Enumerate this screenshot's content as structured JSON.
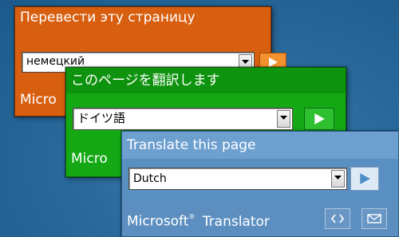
{
  "widgets": [
    {
      "language": "ru",
      "title": "Перевести эту страницу",
      "selected_language": "немецкий",
      "footer_brand": "Micro",
      "colors": {
        "background": "#d85f10",
        "go_button": "#f3922e"
      }
    },
    {
      "language": "ja",
      "title": "このページを翻訳します",
      "selected_language": "ドイツ語",
      "footer_brand": "Micro",
      "colors": {
        "background": "#14a914",
        "go_button": "#2fc02f"
      }
    },
    {
      "language": "en",
      "title": "Translate this page",
      "selected_language": "Dutch",
      "footer_brand": "Microsoft",
      "footer_product": "Translator",
      "colors": {
        "background": "#5a8fc1",
        "go_button": "#dde9f5"
      },
      "footer_icons": [
        "code-embed-icon",
        "email-icon"
      ]
    }
  ],
  "icons": {
    "dropdown": "chevron-down-icon",
    "go": "play-arrow-icon"
  }
}
